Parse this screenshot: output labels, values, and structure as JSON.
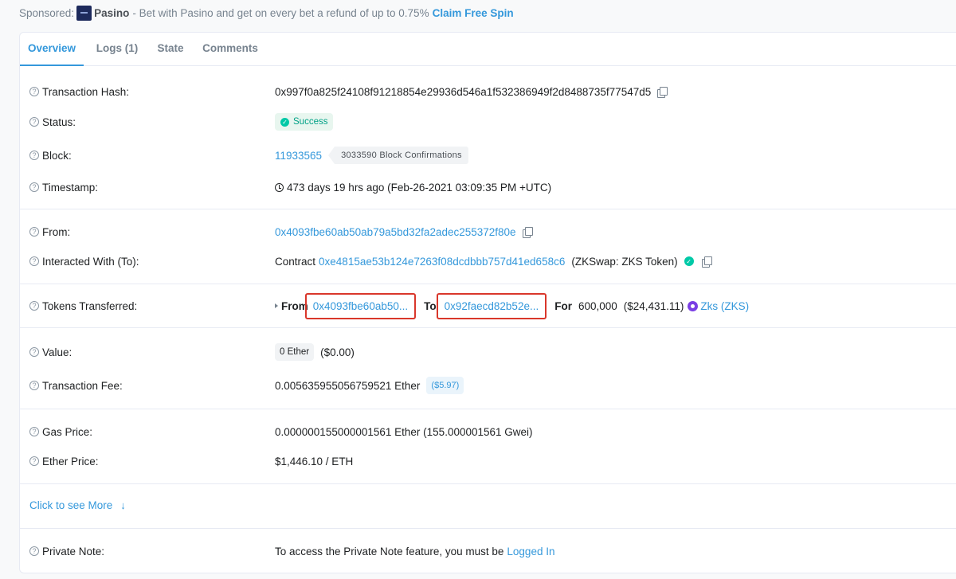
{
  "sponsor": {
    "prefix": "Sponsored:",
    "brand": "Pasino",
    "text": "- Bet with Pasino and get on every bet a refund of up to 0.75%",
    "cta": "Claim Free Spin"
  },
  "tabs": [
    {
      "label": "Overview",
      "active": true
    },
    {
      "label": "Logs (1)",
      "active": false
    },
    {
      "label": "State",
      "active": false
    },
    {
      "label": "Comments",
      "active": false
    }
  ],
  "tx": {
    "hash_label": "Transaction Hash:",
    "hash": "0x997f0a825f24108f91218854e29936d546a1f532386949f2d8488735f77547d5",
    "status_label": "Status:",
    "status": "Success",
    "block_label": "Block:",
    "block": "11933565",
    "confirmations": "3033590 Block Confirmations",
    "timestamp_label": "Timestamp:",
    "timestamp": "473 days 19 hrs ago (Feb-26-2021 03:09:35 PM +UTC)",
    "from_label": "From:",
    "from": "0x4093fbe60ab50ab79a5bd32fa2adec255372f80e",
    "to_label": "Interacted With (To):",
    "to_prefix": "Contract",
    "to_address": "0xe4815ae53b124e7263f08dcdbbb757d41ed658c6",
    "to_name": "(ZKSwap: ZKS Token)",
    "tokens_label": "Tokens Transferred:",
    "tokens": {
      "from_kw": "From",
      "from_addr": "0x4093fbe60ab50...",
      "to_kw": "To",
      "to_addr": "0x92faecd82b52e...",
      "for_kw": "For",
      "amount": "600,000",
      "amount_usd": "($24,431.11)",
      "token": "Zks (ZKS)"
    },
    "value_label": "Value:",
    "value": "0 Ether",
    "value_usd": "($0.00)",
    "fee_label": "Transaction Fee:",
    "fee": "0.005635955056759521 Ether",
    "fee_usd": "($5.97)",
    "gas_label": "Gas Price:",
    "gas": "0.000000155000001561 Ether (155.000001561 Gwei)",
    "ether_price_label": "Ether Price:",
    "ether_price": "$1,446.10 / ETH",
    "more": "Click to see More",
    "note_label": "Private Note:",
    "note_text": "To access the Private Note feature, you must be",
    "note_link": "Logged In"
  },
  "colors": {
    "link": "#3498db",
    "success": "#00c9a7",
    "highlight": "#d9372b"
  }
}
